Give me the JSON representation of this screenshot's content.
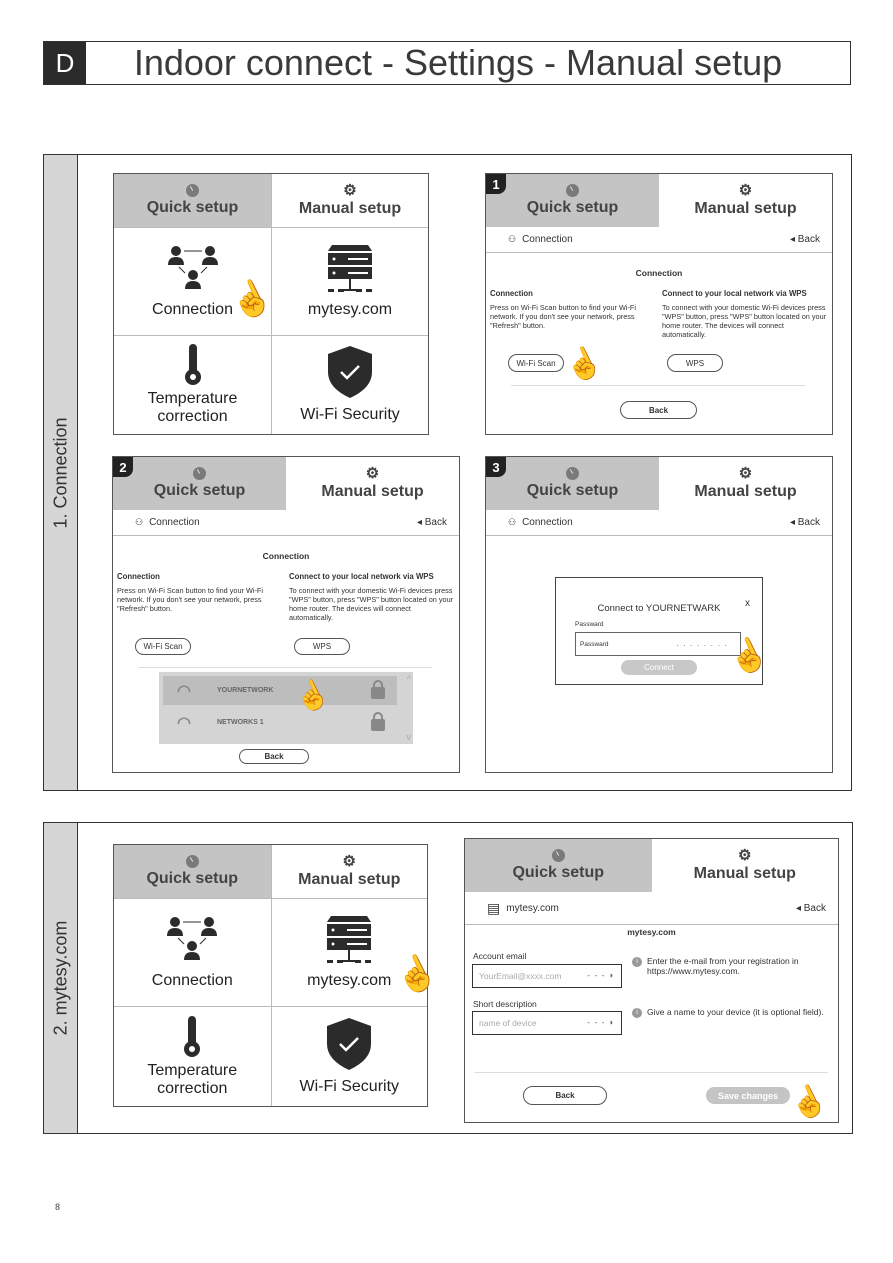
{
  "header": {
    "letter": "D",
    "title": "Indoor connect - Settings - Manual setup"
  },
  "tabs": {
    "quick": "Quick setup",
    "manual": "Manual setup"
  },
  "menu": {
    "connection": "Connection",
    "mytesy": "mytesy.com",
    "temperature": "Temperature correction",
    "security": "Wi-Fi Security"
  },
  "section1": {
    "label": "1. Connection",
    "steps": [
      "1",
      "2",
      "3"
    ],
    "subbar_label": "Connection",
    "back_link": "Back",
    "content_title": "Connection",
    "left_heading": "Connection",
    "left_text": "Press on Wi-Fi Scan button to find your Wi-Fi network. If you don't see your network, press \"Refresh\" button.",
    "right_heading": "Connect to your local network via WPS",
    "right_text": "To connect with your domestic Wi-Fi devices press \"WPS\" button, press \"WPS\" button located on your home router. The devices will connect automatically.",
    "wifi_scan_button": "Wi-Fi Scan",
    "wps_button": "WPS",
    "back_button": "Back",
    "networks": [
      "YOURNETWORK",
      "NETWORKS 1"
    ],
    "dialog": {
      "title": "Connect to YOURNETWARK",
      "close": "x",
      "password_label": "Passward",
      "password_placeholder": "Passward",
      "password_dots": "· · · · · · · ·",
      "connect_button": "Connect"
    }
  },
  "section2": {
    "label": "2. mytesy.com",
    "subbar_label": "mytesy.com",
    "back_link": "Back",
    "content_title": "mytesy.com",
    "email_label": "Account email",
    "email_placeholder": "YourEmail@xxxx.com",
    "email_hint": "Enter the e-mail from your registration in https://www.mytesy.com.",
    "desc_label": "Short description",
    "desc_placeholder": "name of device",
    "desc_hint": "Give a name to your device (it is optional field).",
    "back_button": "Back",
    "save_button": "Save changes"
  },
  "page_number": "8"
}
